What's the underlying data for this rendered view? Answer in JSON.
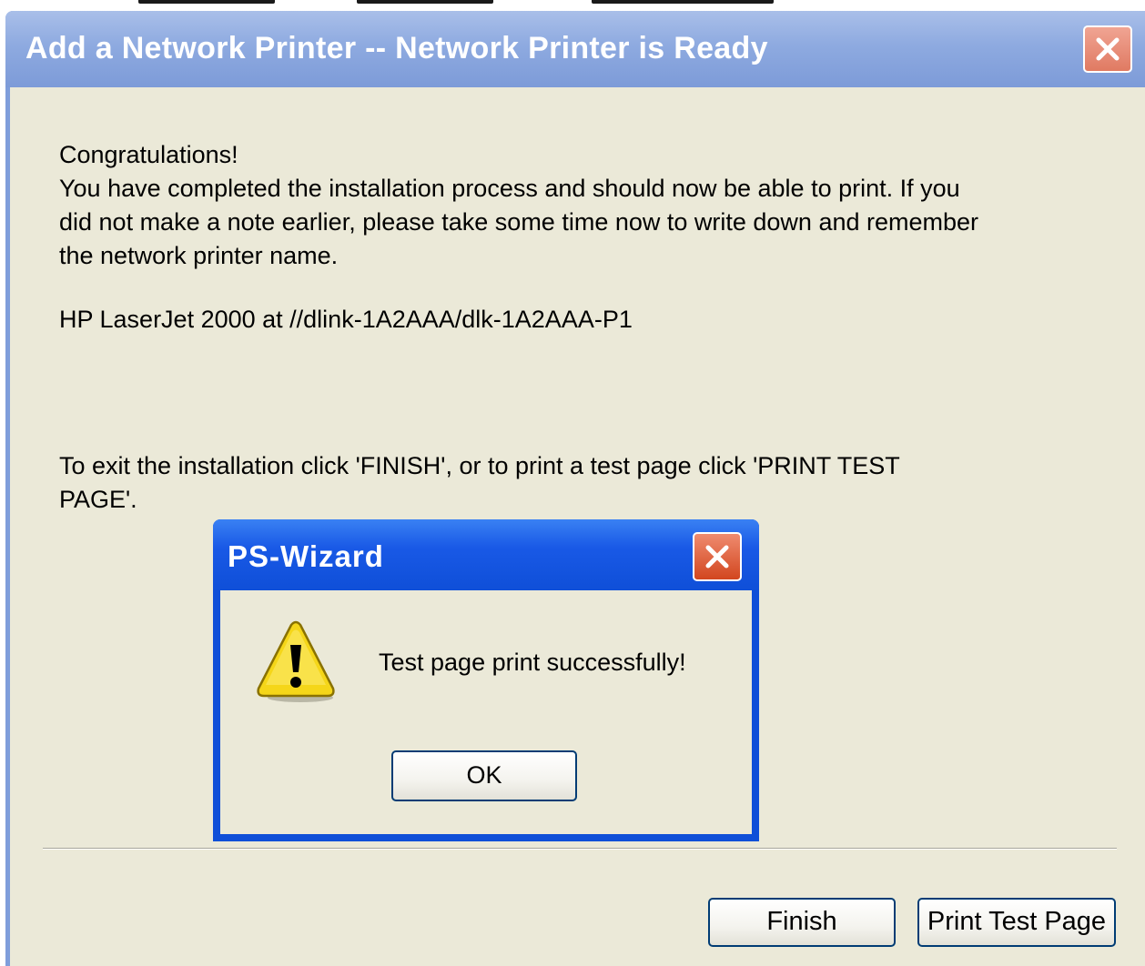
{
  "main_dialog": {
    "title": "Add a Network Printer -- Network Printer is Ready",
    "heading": "Congratulations!",
    "description_lines": [
      "You have completed the installation process and should now be able to print. If you",
      "did not make a note earlier, please take some time now to write down and remember",
      "the network printer name."
    ],
    "printer_name": "HP LaserJet 2000 at //dlink-1A2AAA/dlk-1A2AAA-P1",
    "instruction_lines": [
      "To exit the installation click 'FINISH', or to print a test page click 'PRINT TEST",
      "PAGE'."
    ],
    "buttons": {
      "finish": "Finish",
      "print_test_page": "Print Test Page"
    },
    "close_icon": "close-icon"
  },
  "message_box": {
    "title": "PS-Wizard",
    "icon": "warning-icon",
    "message": "Test page print successfully!",
    "ok_label": "OK",
    "close_icon": "close-icon"
  }
}
